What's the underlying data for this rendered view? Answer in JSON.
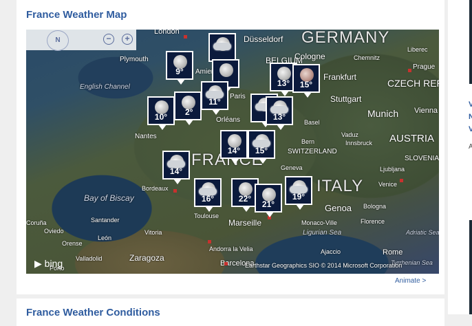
{
  "section": {
    "title": "France Weather Map",
    "next_title": "France Weather Conditions",
    "animate_label": "Animate >"
  },
  "map_controls": {
    "compass_label": "N",
    "zoom_out": "−",
    "zoom_in": "+"
  },
  "attribution": {
    "brand": "bing",
    "copyright": "Earthstar Geographics SIO   © 2014 Microsoft Corporation"
  },
  "countries": [
    "GERMANY",
    "BELGIUM",
    "FRANCE",
    "SWITZERLAND",
    "AUSTRIA",
    "ITALY",
    "CZECH REP.",
    "SLOVENIA"
  ],
  "cities": [
    "London",
    "Düsseldorf",
    "Plymouth",
    "Cologne",
    "Chemnitz",
    "Liberec",
    "Prague",
    "Frankfurt",
    "Amiens",
    "Paris",
    "Orléans",
    "Nantes",
    "Basel",
    "Stuttgart",
    "Munich",
    "Vienna",
    "Bern",
    "Vaduz",
    "Innsbruck",
    "Geneva",
    "Ljubljana",
    "Bordeaux",
    "Venice",
    "Toulouse",
    "Genoa",
    "Bologna",
    "Florence",
    "Monaco-Ville",
    "Marseille",
    "Ajaccio",
    "Rome",
    "Coruña",
    "Santander",
    "Oviedo",
    "León",
    "Vitoria",
    "Orense",
    "Valladolid",
    "Zaragoza",
    "Andorra la Velia",
    "Barcelona",
    "Porto"
  ],
  "seas": [
    "English Channel",
    "Bay of Biscay",
    "Ligurian Sea",
    "Tyrrhenian Sea",
    "Adriatic Sea"
  ],
  "markers": [
    {
      "temp": "9°",
      "icon": "moon"
    },
    {
      "temp": "11°",
      "icon": "moon-cloud"
    },
    {
      "temp": "13°",
      "icon": "moon"
    },
    {
      "temp": "15°",
      "icon": "dusk"
    },
    {
      "temp": "10°",
      "icon": "moon"
    },
    {
      "temp": "2°",
      "icon": "moon"
    },
    {
      "temp": "13°",
      "icon": "cloud"
    },
    {
      "temp": "14°",
      "icon": "moon"
    },
    {
      "temp": "15°",
      "icon": "rain"
    },
    {
      "temp": "14°",
      "icon": "cloud"
    },
    {
      "temp": "16°",
      "icon": "cloud"
    },
    {
      "temp": "22°",
      "icon": "moon"
    },
    {
      "temp": "21°",
      "icon": "moon"
    },
    {
      "temp": "19°",
      "icon": "moon-cloud"
    }
  ],
  "sidebar": {
    "snippet_1": "V",
    "snippet_2": "N",
    "snippet_3": "V",
    "snippet_4": "A"
  }
}
